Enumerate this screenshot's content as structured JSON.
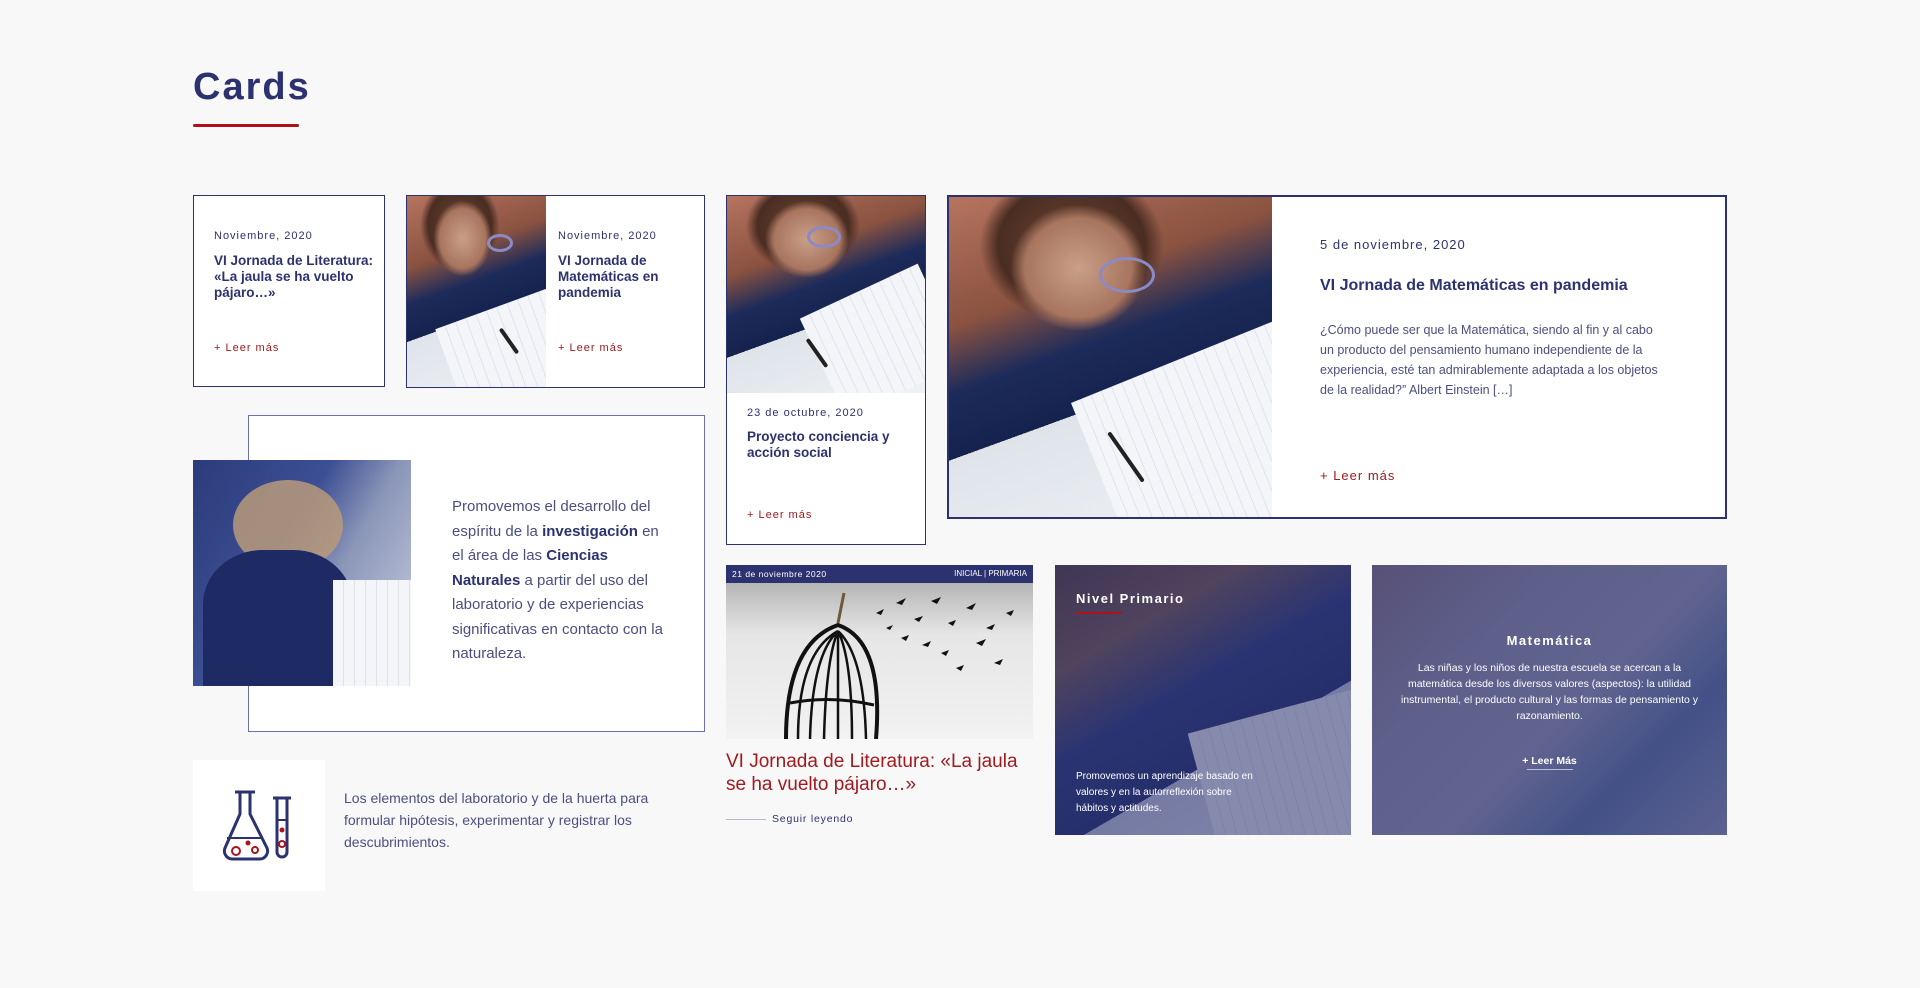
{
  "page": {
    "title": "Cards"
  },
  "colors": {
    "navy": "#2c3270",
    "accent_red": "#a01a1f",
    "background": "#f8f8f9"
  },
  "card1": {
    "date": "Noviembre, 2020",
    "title": "VI Jornada de Literatura: «La jaula se ha vuelto pájaro…»",
    "more": "+ Leer más"
  },
  "card2": {
    "date": "Noviembre, 2020",
    "title": "VI Jornada de Matemáticas en pandemia",
    "more": "+ Leer más"
  },
  "card3": {
    "date": "23 de octubre, 2020",
    "title": "Proyecto conciencia y acción social",
    "more": "+ Leer más"
  },
  "card4": {
    "date": "5 de noviembre, 2020",
    "title": "VI Jornada de Matemáticas en pandemia",
    "excerpt": "¿Cómo puede ser que la Matemática, siendo al fin y al cabo un producto del pensamiento humano independiente de la experiencia, esté tan admirablemente adaptada a los objetos de la realidad?” Albert Einstein […]",
    "more": "+ Leer más"
  },
  "card5": {
    "text_1": "Promovemos el desarrollo del espíritu de la ",
    "bold_1": "investigación",
    "text_2": " en el área de las ",
    "bold_2": "Ciencias Naturales",
    "text_3": " a partir del uso del laboratorio y de experiencias significativas en contacto con la naturaleza."
  },
  "card6": {
    "icon": "flask-icon",
    "text": "Los elementos del laboratorio y de la huerta para formular hipótesis, experimentar y registrar los descubrimientos."
  },
  "card7": {
    "date": "21 de noviembre 2020",
    "tags": "INICIAL | PRIMARIA",
    "title": "VI Jornada de Literatura: «La jaula se ha vuelto pájaro…»",
    "more": "Seguir leyendo"
  },
  "card8": {
    "heading": "Nivel Primario",
    "text": "Promovemos un aprendizaje basado en valores y en la autorreflexión sobre hábitos y actitudes."
  },
  "card9": {
    "heading": "Matemática",
    "text": "Las niñas y los niños de nuestra escuela se acercan a la matemática desde los diversos valores (aspectos): la utilidad instrumental, el producto cultural y las formas de pensamiento y razonamiento.",
    "more": "+ Leer Más"
  }
}
